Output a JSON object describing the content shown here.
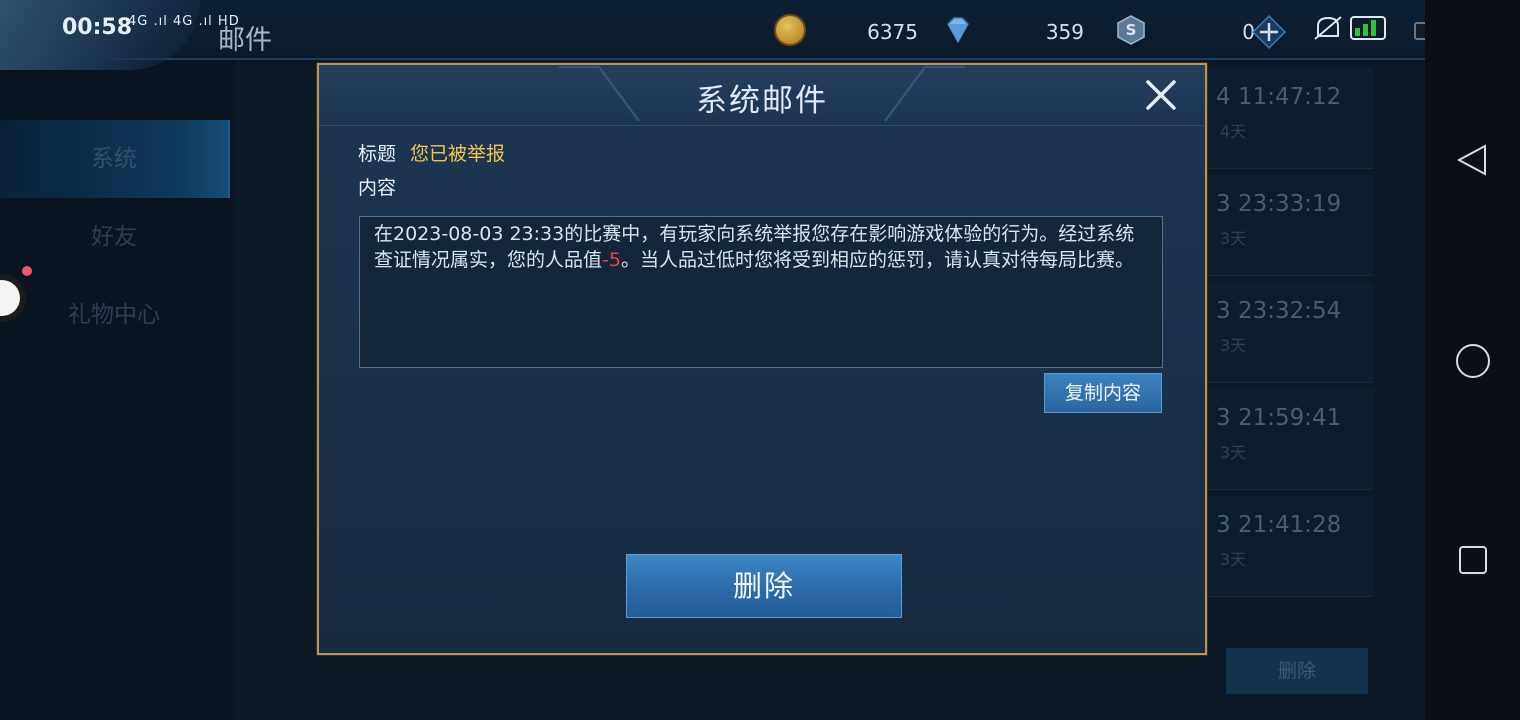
{
  "status_bar": {
    "time": "00:58",
    "network": "4G .ıl 4G .ıl HD"
  },
  "page_title": "邮件",
  "resources": {
    "gold": "6375",
    "diamond": "359",
    "coupon": "0"
  },
  "sidebar": {
    "items": [
      {
        "label": "系统"
      },
      {
        "label": "好友"
      },
      {
        "label": "礼物中心"
      }
    ]
  },
  "mail_list": [
    {
      "time": "4 11:47:12",
      "age": "4天"
    },
    {
      "time": "3 23:33:19",
      "age": "3天"
    },
    {
      "time": "3 23:32:54",
      "age": "3天"
    },
    {
      "time": "3 21:59:41",
      "age": "3天"
    },
    {
      "time": "3 21:41:28",
      "age": "3天"
    }
  ],
  "bg_delete_label": "删除",
  "dialog": {
    "title": "系统邮件",
    "subject_label": "标题",
    "subject_value": "您已被举报",
    "content_label": "内容",
    "content_part1": "在2023-08-03 23:33的比赛中，有玩家向系统举报您存在影响游戏体验的行为。经过系统查证情况属实，您的人品值",
    "content_penalty": "-5",
    "content_part2": "。当人品过低时您将受到相应的惩罚，请认真对待每局比赛。",
    "copy_label": "复制内容",
    "delete_label": "删除"
  },
  "colors": {
    "subject": "#f1c84e",
    "penalty": "#e0463e",
    "dialog_border": "#b8965a",
    "button": "#2c6aa8"
  },
  "icons": [
    "gold-coin-icon",
    "diamond-icon",
    "coupon-icon",
    "plus-icon",
    "close-icon",
    "back-icon",
    "home-icon",
    "recents-icon",
    "battery-icon"
  ]
}
